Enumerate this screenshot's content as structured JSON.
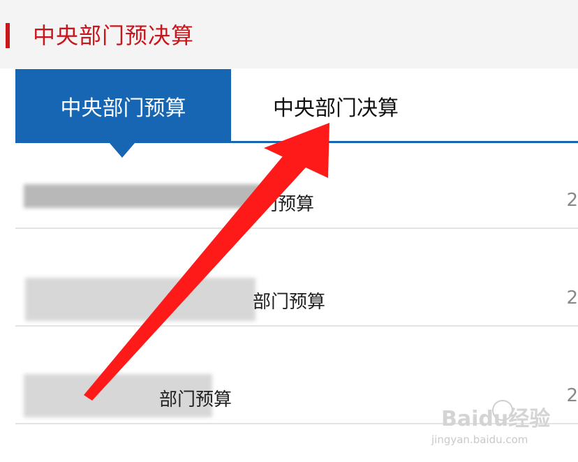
{
  "header": {
    "title": "中央部门预决算"
  },
  "tabs": [
    {
      "label": "中央部门预算",
      "active": true
    },
    {
      "label": "中央部门决算",
      "active": false
    }
  ],
  "list": [
    {
      "title": "门预算",
      "date": "2"
    },
    {
      "title": "部门预算",
      "date": "2"
    },
    {
      "title": "部门预算",
      "date": "2"
    }
  ],
  "watermark": {
    "main": "Baidu经验",
    "sub": "jingyan.baidu.com"
  },
  "colors": {
    "accent_blue": "#1766b3",
    "header_red": "#c8161d",
    "arrow_red": "#ff1a1a"
  }
}
